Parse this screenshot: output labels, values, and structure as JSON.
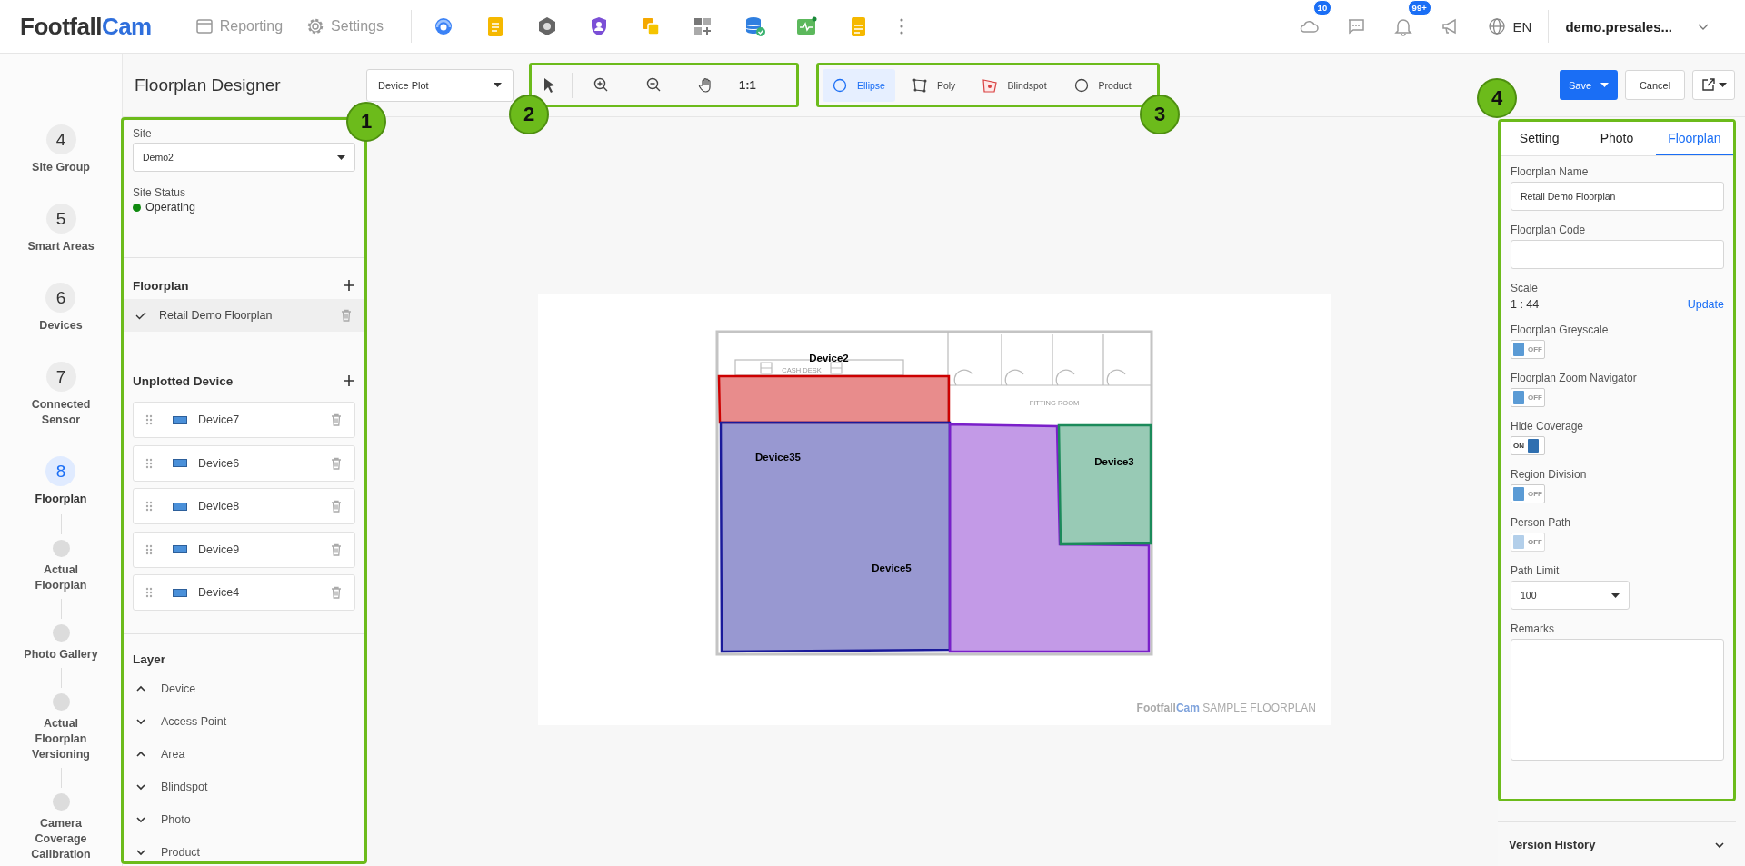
{
  "header": {
    "logo": [
      "Footfall",
      "Cam"
    ],
    "nav": [
      {
        "label": "Reporting"
      },
      {
        "label": "Settings"
      }
    ],
    "notification_badges": [
      "10",
      "99+"
    ],
    "language": "EN",
    "user": "demo.presales..."
  },
  "steps": [
    {
      "number": "4",
      "label": "Site Group",
      "selected": false
    },
    {
      "number": "5",
      "label": "Smart Areas",
      "selected": false
    },
    {
      "number": "6",
      "label": "Devices",
      "selected": false
    },
    {
      "number": "7",
      "label": "Connected Sensor",
      "selected": false
    },
    {
      "number": "8",
      "label": "Floorplan",
      "selected": true
    },
    {
      "label": "Actual Floorplan",
      "selected": false
    },
    {
      "label": "Photo Gallery",
      "selected": false
    },
    {
      "label": "Actual Floorplan Versioning",
      "selected": false
    },
    {
      "label": "Camera Coverage Calibration",
      "selected": false
    }
  ],
  "toolbar": {
    "title": "Floorplan Designer",
    "mode_select": "Device Plot",
    "view_callout": "2",
    "zoom_reset": "1:1",
    "draw_callout": "3",
    "draw_tools": [
      {
        "label": "Ellipse",
        "selected": true
      },
      {
        "label": "Poly",
        "selected": false
      },
      {
        "label": "Blindspot",
        "selected": false
      },
      {
        "label": "Product",
        "selected": false
      }
    ],
    "save": "Save",
    "cancel": "Cancel"
  },
  "left_panel": {
    "callout": "1",
    "site_label": "Site",
    "site_value": "Demo2",
    "status_label": "Site Status",
    "status": {
      "text": "Operating",
      "color": "#108a10"
    },
    "floorplan_heading": "Floorplan",
    "floorplans": [
      {
        "name": "Retail Demo Floorplan",
        "selected": true
      }
    ],
    "unplotted_heading": "Unplotted Device",
    "devices": [
      "Device7",
      "Device6",
      "Device8",
      "Device9",
      "Device4"
    ],
    "layer_heading": "Layer",
    "layers": [
      {
        "name": "Device",
        "expanded": true
      },
      {
        "name": "Access Point",
        "expanded": false
      },
      {
        "name": "Area",
        "expanded": true
      },
      {
        "name": "Blindspot",
        "expanded": false
      },
      {
        "name": "Photo",
        "expanded": false
      },
      {
        "name": "Product",
        "expanded": false
      }
    ]
  },
  "canvas": {
    "plan_labels": [
      "CASH DESK",
      "FITTING ROOM"
    ],
    "areas": [
      {
        "color": "#cc0000"
      },
      {
        "color": "#1a1a9a"
      },
      {
        "color": "#7a1fc9"
      },
      {
        "color": "#1b8a5a"
      }
    ],
    "device_labels": [
      "Device2",
      "Device35",
      "Device5",
      "Device3"
    ],
    "caption": {
      "brand": [
        "Footfall",
        "Cam"
      ],
      "text": "SAMPLE FLOORPLAN"
    }
  },
  "right_panel": {
    "callout": "4",
    "tabs": [
      {
        "label": "Setting",
        "selected": false
      },
      {
        "label": "Photo",
        "selected": false
      },
      {
        "label": "Floorplan",
        "selected": true
      }
    ],
    "fields": [
      {
        "kind": "text",
        "label": "Floorplan Name",
        "value": "Retail Demo Floorplan"
      },
      {
        "kind": "text",
        "label": "Floorplan Code"
      },
      {
        "kind": "scale",
        "label": "Scale",
        "value": "1 : 44",
        "link": "Update"
      },
      {
        "kind": "toggle",
        "label": "Floorplan Greyscale",
        "on": false,
        "disabled": false,
        "state_text": "OFF"
      },
      {
        "kind": "toggle",
        "label": "Floorplan Zoom Navigator",
        "on": false,
        "disabled": false,
        "state_text": "OFF"
      },
      {
        "kind": "toggle",
        "label": "Hide Coverage",
        "on": true,
        "disabled": false,
        "state_text": "ON"
      },
      {
        "kind": "toggle",
        "label": "Region Division",
        "on": false,
        "disabled": false,
        "state_text": "OFF"
      },
      {
        "kind": "toggle",
        "label": "Person Path",
        "on": false,
        "disabled": true,
        "state_text": "OFF"
      },
      {
        "kind": "select",
        "label": "Path Limit",
        "value": "100"
      },
      {
        "kind": "textarea",
        "label": "Remarks"
      }
    ],
    "version_history": {
      "label": "Version History",
      "expanded": false
    }
  }
}
